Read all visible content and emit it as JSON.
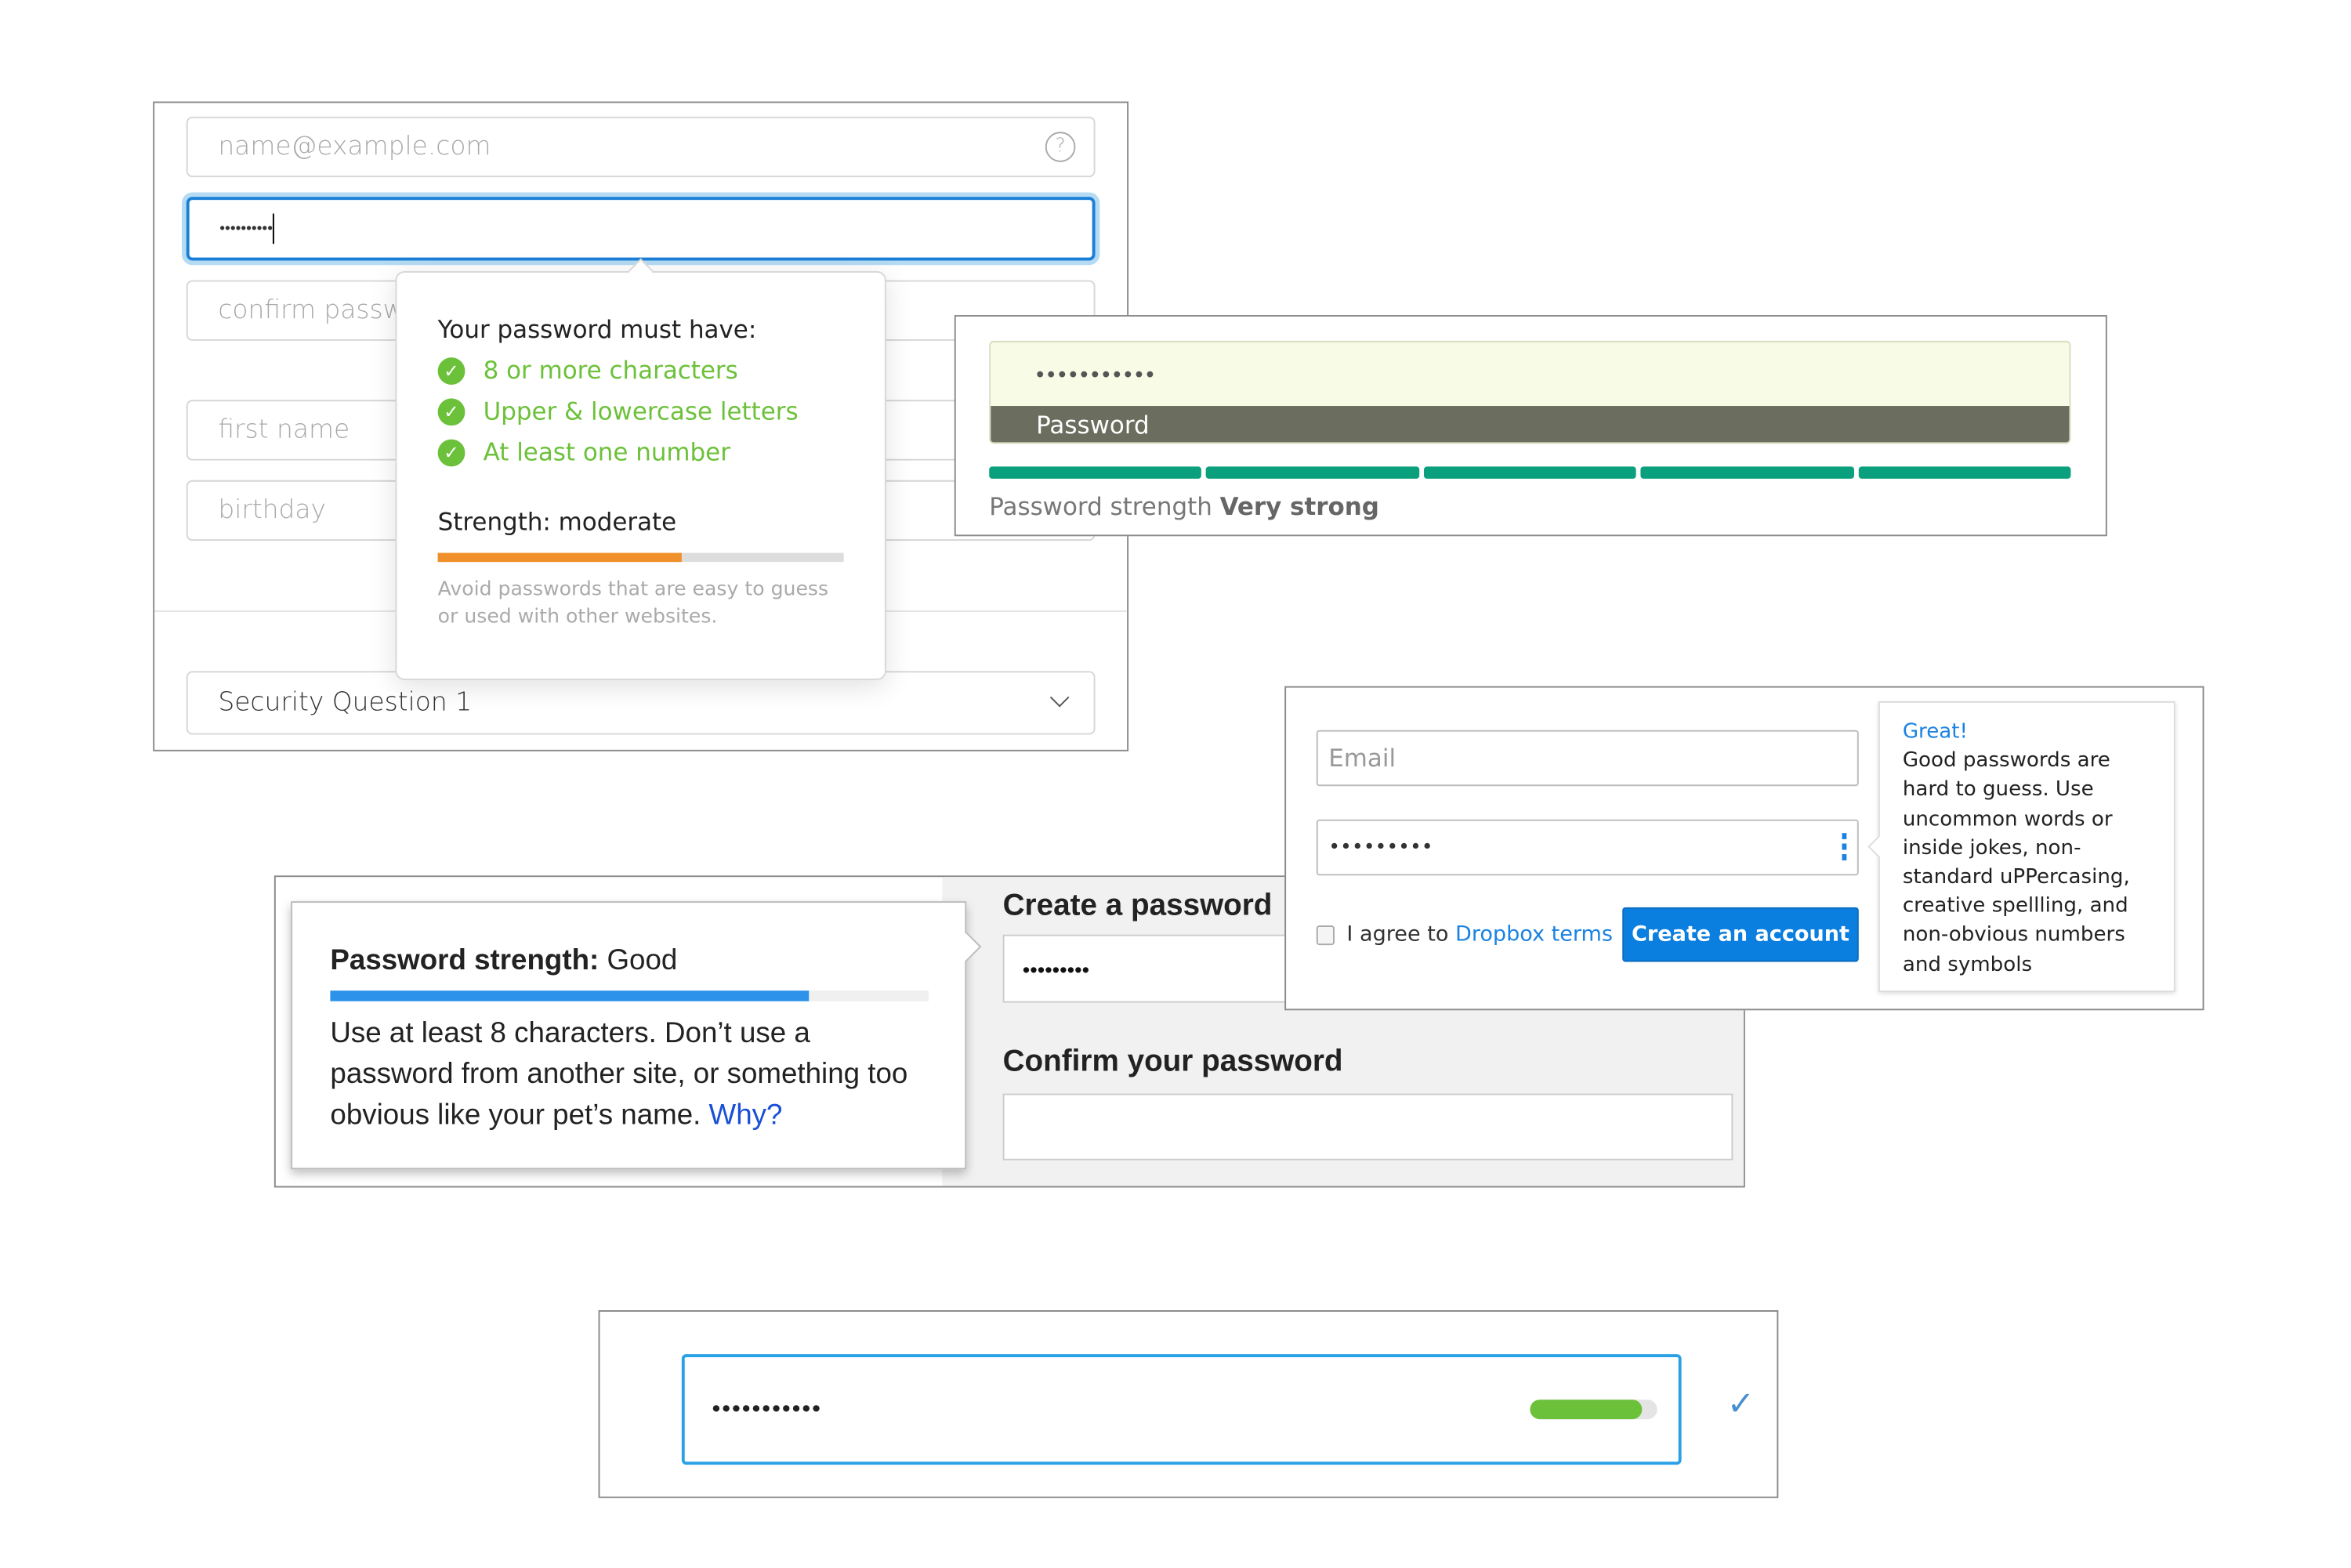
{
  "panel_apple": {
    "email_placeholder": "name@example.com",
    "password_value": "••••••••••",
    "confirm_placeholder": "confirm password",
    "first_name_placeholder": "first name",
    "birthday_placeholder": "birthday",
    "security_question": "Security Question 1",
    "popover": {
      "title": "Your password must have:",
      "rules": [
        "8 or more characters",
        "Upper & lowercase letters",
        "At least one number"
      ],
      "strength_label": "Strength: moderate",
      "strength_fraction": 0.6,
      "hint": "Avoid passwords that are easy to guess or used with other websites."
    },
    "colors": {
      "rule_green": "#6cc13a",
      "bar_orange": "#f0902a",
      "focus_blue": "#1a7fd6"
    }
  },
  "panel_strength": {
    "password_value": "•••••••••••",
    "field_label": "Password",
    "strength_prefix": "Password strength",
    "strength_value": "Very strong",
    "segments_filled": 5,
    "segments_total": 5,
    "colors": {
      "bar": "#0aa07e",
      "field_bg": "#f8fbe6",
      "label_bg": "#6b6d5e"
    }
  },
  "panel_dropbox": {
    "email_placeholder": "Email",
    "password_value": "•••••••••",
    "agree_text": "I agree to",
    "terms_link": "Dropbox terms",
    "create_button": "Create an account",
    "tooltip_title": "Great!",
    "tooltip_body": "Good passwords are hard to guess. Use uncommon words or inside jokes, non-standard uPPercasing, creative spellling, and non-obvious numbers and symbols",
    "colors": {
      "button": "#0a7fe0",
      "link": "#1a82e2"
    }
  },
  "panel_google": {
    "popover_title": "Password strength:",
    "popover_value": "Good",
    "strength_fraction": 0.8,
    "popover_body": "Use at least 8 characters. Don’t use a password from another site, or something too obvious like your pet’s name.",
    "why_link": "Why?",
    "create_label": "Create a password",
    "password_value": "•••••••••",
    "confirm_label": "Confirm your password",
    "colors": {
      "bar": "#2d93ea",
      "link": "#1a4fd6"
    }
  },
  "panel_meter": {
    "password_value": "•••••••••••",
    "strength_fraction": 0.88,
    "colors": {
      "bar": "#6cc13a",
      "border": "#2aa0e6",
      "check": "#4a8fd0"
    }
  }
}
